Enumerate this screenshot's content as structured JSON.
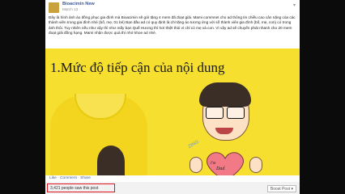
{
  "post": {
    "page_name": "Bioacimin New",
    "date": "March 13 · ",
    "menu_icon": "chevron-down-icon",
    "caption": "Đây là hình ảnh áo đồng phục gia đình mà Bioacimin sẽ gửi tặng 4 mem đã đoạt giải. Mami commnet cho ad thông tin chiều cao cân nặng của các thành viên trong gia đình nhé (bố, mẹ, 01 bé) Bạn đầu ad có quy định là chỉ tặng áo tương ứng với số thành viên gia đình (bố, mẹ, con) có trong ảnh thôi. Tuy nhiên nếu như vậy thì như mấy bạn Quế Hương thì hơi thiệt thòi vì chỉ có mẹ và con. Vì vậy ad sẽ chuyển phát nhanh cho 20 mem đoạt giải đồng hạng. Mami nhận được quà thì nhớ khoe ad nhé."
  },
  "image": {
    "headline": "1.Mức độ tiếp cận của nội dung",
    "heart_text_1": "I'm",
    "heart_text_2": "Dad",
    "watermark": "ZING"
  },
  "footer": {
    "actions": "Like · Comment · Share",
    "seen": "3,421 people saw this post",
    "boost": "Boost Post ▾"
  },
  "colors": {
    "link": "#3b5998",
    "highlight_box": "#e0141c",
    "shirt_yellow": "#f6df2f"
  }
}
